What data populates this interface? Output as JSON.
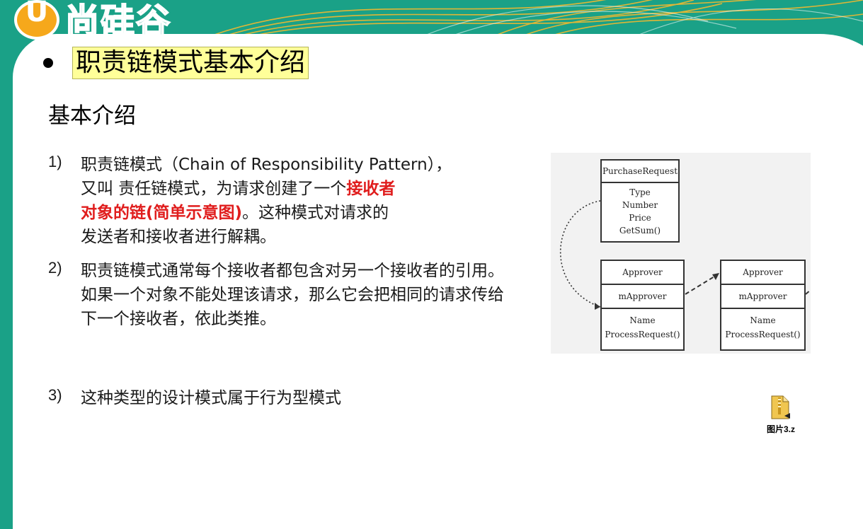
{
  "logo": {
    "mark": "U",
    "name": "尚硅谷"
  },
  "slide": {
    "title": "职责链模式基本介绍",
    "subheading": "基本介绍",
    "items": [
      {
        "number": "1)",
        "line1": "职责链模式（Chain of Responsibility Pattern），",
        "line2_prefix": "又叫 责任链模式，为请求创建了一个",
        "highlight_a": "接收者",
        "highlight_b": "对象的链(简单示意图)",
        "after_highlight": "。这种模式对请求的",
        "line4": "发送者和接收者进行解耦。"
      },
      {
        "number": "2)",
        "text": "职责链模式通常每个接收者都包含对另一个接收者的引用。如果一个对象不能处理该请求，那么它会把相同的请求传给下一个接收者，依此类推。"
      },
      {
        "number": "3)",
        "text": "这种类型的设计模式属于行为型模式"
      }
    ]
  },
  "diagram": {
    "request_class": {
      "name": "PurchaseRequest",
      "fields": [
        "Type",
        "Number",
        "Price",
        "GetSum()"
      ]
    },
    "approvers": [
      {
        "name": "Approver",
        "field": "mApprover",
        "methods": [
          "Name",
          "ProcessRequest()"
        ]
      },
      {
        "name": "Approver",
        "field": "mApprover",
        "methods": [
          "Name",
          "ProcessRequest()"
        ]
      }
    ]
  },
  "attachment": {
    "icon": "zip-file-icon",
    "label": "图片3.z"
  },
  "colors": {
    "teal": "#1aa187",
    "orange": "#f6a81b",
    "highlight_bg": "#ffff99",
    "red": "#e01d1d"
  }
}
